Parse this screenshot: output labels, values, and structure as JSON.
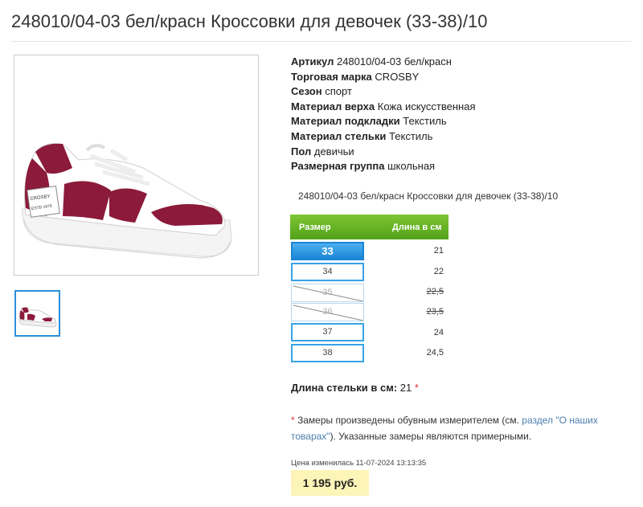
{
  "page": {
    "title": "248010/04-03 бел/красн Кроссовки для девочек (33-38)/10"
  },
  "gallery": {
    "main_image_icon": "sneaker-photo",
    "thumbnail_icon": "sneaker-thumbnail",
    "shoe_label_brand": "CROSBY",
    "shoe_label_est": "ESTD 1978"
  },
  "specs": [
    {
      "label": "Артикул",
      "value": "248010/04-03 бел/красн"
    },
    {
      "label": "Торговая марка",
      "value": "CROSBY"
    },
    {
      "label": "Сезон",
      "value": "спорт"
    },
    {
      "label": "Материал верха",
      "value": "Кожа искусственная"
    },
    {
      "label": "Материал подкладки",
      "value": "Текстиль"
    },
    {
      "label": "Материал стельки",
      "value": "Текстиль"
    },
    {
      "label": "Пол",
      "value": "девичьи"
    },
    {
      "label": "Размерная группа",
      "value": "школьная"
    }
  ],
  "product_name": "248010/04-03 бел/красн Кроссовки для девочек (33-38)/10",
  "size_table": {
    "header_size": "Размер",
    "header_length": "Длина в см",
    "rows": [
      {
        "size": "33",
        "length": "21",
        "selected": true,
        "available": true
      },
      {
        "size": "34",
        "length": "22",
        "selected": false,
        "available": true
      },
      {
        "size": "35",
        "length": "22,5",
        "selected": false,
        "available": false
      },
      {
        "size": "36",
        "length": "23,5",
        "selected": false,
        "available": false
      },
      {
        "size": "37",
        "length": "24",
        "selected": false,
        "available": true
      },
      {
        "size": "38",
        "length": "24,5",
        "selected": false,
        "available": true
      }
    ],
    "colors": {
      "header": "#6ab628",
      "selected": "#1a85d6",
      "border": "#38a2e6"
    }
  },
  "insole": {
    "label": "Длина стельки в см:",
    "value": "21",
    "star": "*"
  },
  "note": {
    "star": "*",
    "text_before": " Замеры произведены обувным измерителем (см. ",
    "link": "раздел \"О наших товарах\"",
    "text_after": "). Указанные замеры являются примерными."
  },
  "price": {
    "changed": "Цена изменилась 11-07-2024 13:13:35",
    "value": "1 195 руб."
  }
}
